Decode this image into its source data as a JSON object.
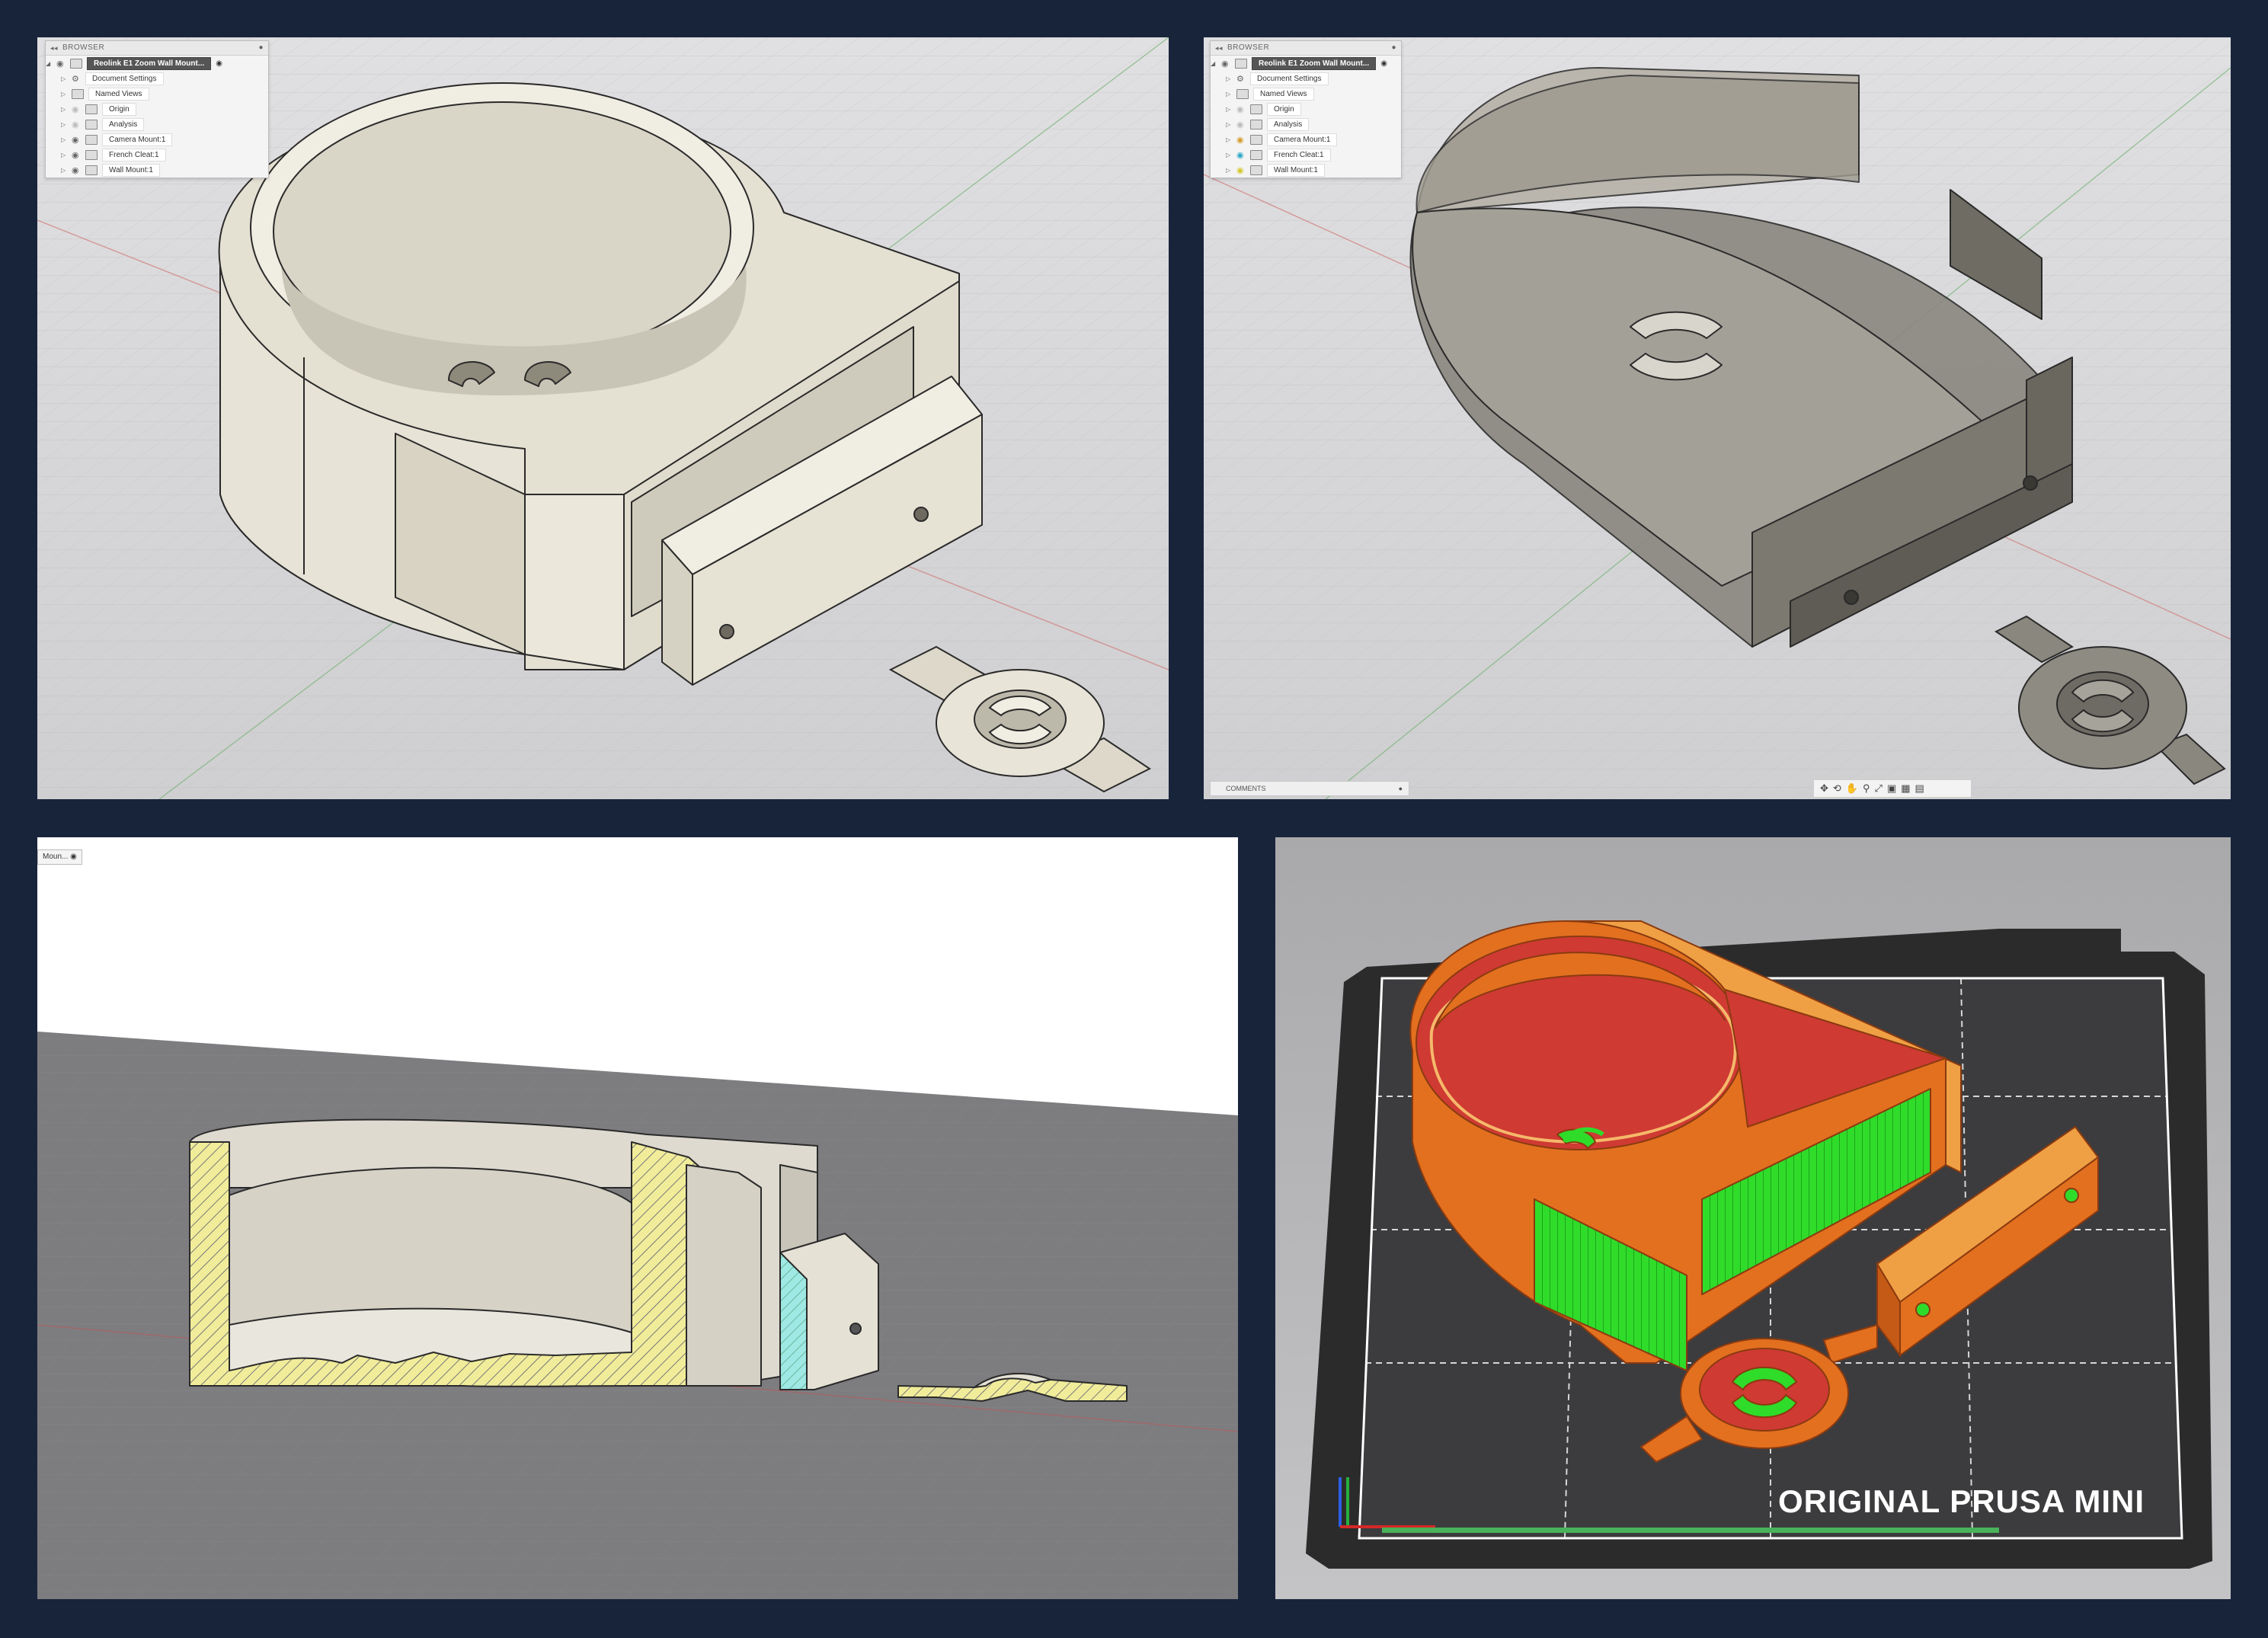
{
  "panels": {
    "top_left": {
      "browser": {
        "header": "BROWSER",
        "root": "Reolink E1 Zoom Wall Mount...",
        "items": [
          {
            "label": "Document Settings",
            "icon": "gear-icon",
            "visible": false
          },
          {
            "label": "Named Views",
            "icon": "folder-icon",
            "visible": false
          },
          {
            "label": "Origin",
            "icon": "folder-icon",
            "visible": true
          },
          {
            "label": "Analysis",
            "icon": "folder-icon",
            "visible": true
          },
          {
            "label": "Camera Mount:1",
            "icon": "component-icon",
            "visible": true
          },
          {
            "label": "French Cleat:1",
            "icon": "component-icon",
            "visible": true
          },
          {
            "label": "Wall Mount:1",
            "icon": "component-icon",
            "visible": true
          }
        ]
      }
    },
    "top_right": {
      "browser": {
        "header": "BROWSER",
        "root": "Reolink E1 Zoom Wall Mount...",
        "items": [
          {
            "label": "Document Settings",
            "icon": "gear-icon",
            "visible": false
          },
          {
            "label": "Named Views",
            "icon": "folder-icon",
            "visible": false
          },
          {
            "label": "Origin",
            "icon": "folder-icon",
            "visible": true
          },
          {
            "label": "Analysis",
            "icon": "folder-icon",
            "visible": true
          },
          {
            "label": "Camera Mount:1",
            "icon": "component-icon",
            "visible": true
          },
          {
            "label": "French Cleat:1",
            "icon": "component-icon",
            "visible": true
          },
          {
            "label": "Wall Mount:1",
            "icon": "component-icon",
            "visible": true
          }
        ]
      },
      "comments": "COMMENTS",
      "navbar": [
        "move-icon",
        "orbit-icon",
        "pan-icon",
        "zoom-icon",
        "fit-icon",
        "display-icon",
        "grid-icon",
        "viewports-icon"
      ]
    },
    "bottom_left": {
      "browser_fragment": "Moun..."
    },
    "bottom_right": {
      "printer_label": "ORIGINAL PRUSA MINI"
    }
  },
  "colors": {
    "background": "#18243a",
    "cad_model": "#e4e0d2",
    "cad_viewport": "#d2d2d4",
    "section_hatch": "#f1ec9a",
    "section_hatch_cyan": "#9fe8e4",
    "slicer_orange": "#e2701f",
    "slicer_red": "#cf3a33",
    "slicer_green": "#2fdc2a",
    "bed_black": "#2b2b2b"
  }
}
